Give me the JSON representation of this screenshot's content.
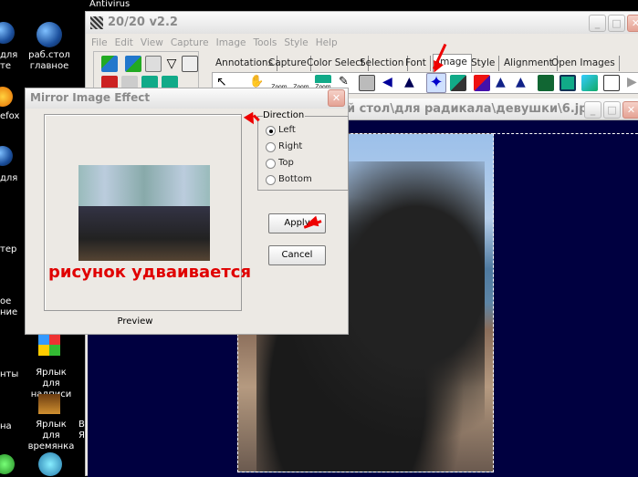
{
  "desktop": {
    "top_text": "Antivirus",
    "icons": [
      {
        "label": "раб.стол главное",
        "icon": "globe-icon"
      },
      {
        "label": "Ярлык для надписи",
        "icon": "windows-shortcut-icon"
      },
      {
        "label": "Ярлык для времянка",
        "icon": "folder-image-shortcut-icon"
      }
    ],
    "cut_labels": [
      "для",
      "те",
      "efox",
      "для",
      "тер",
      "ое",
      "ние",
      "нты",
      "на",
      "В",
      "Я"
    ]
  },
  "app": {
    "title": "20/20 v2.2",
    "menu": [
      "File",
      "Edit",
      "View",
      "Capture",
      "Image",
      "Tools",
      "Style",
      "Help"
    ],
    "tabs": [
      "Annotations",
      "Capture",
      "Color Select",
      "Selection",
      "Font",
      "Image",
      "Style",
      "Alignment",
      "Open Images"
    ],
    "active_tab": "Image",
    "tool_labels": [
      "Zoom",
      "Zoom",
      "Zoom"
    ]
  },
  "image_window": {
    "title": "й стол\\для радикала\\девушки\\6.jpg",
    "background": "#000040"
  },
  "dialog": {
    "title": "Mirror Image Effect",
    "preview_label": "Preview",
    "annotation": "рисунок удваивается",
    "direction": {
      "label": "Direction",
      "options": [
        "Left",
        "Right",
        "Top",
        "Bottom"
      ],
      "selected": "Left"
    },
    "apply_label": "Apply",
    "cancel_label": "Cancel"
  },
  "colors": {
    "annotation_red": "#e00000",
    "canvas_navy": "#000040"
  }
}
